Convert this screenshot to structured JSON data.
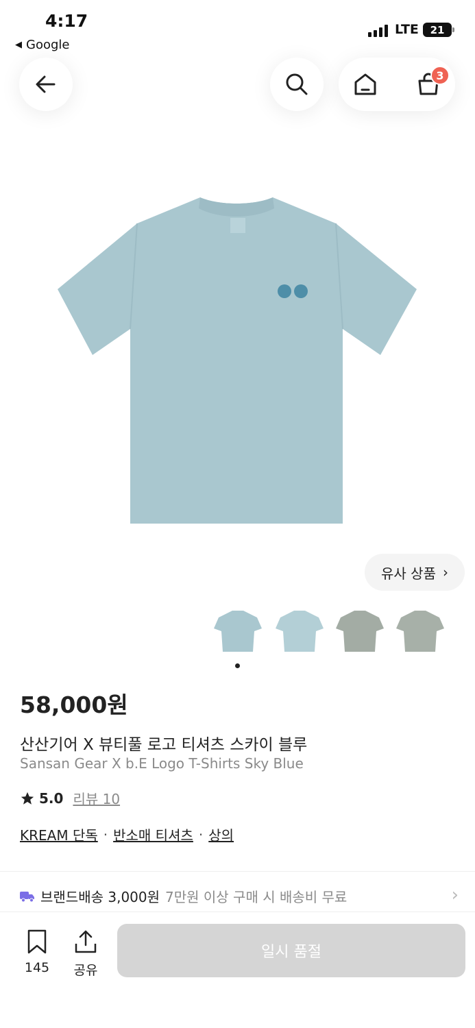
{
  "status": {
    "time": "4:17",
    "back_app": "Google",
    "network": "LTE",
    "battery": "21"
  },
  "header": {
    "cart_count": "3"
  },
  "product": {
    "price": "58,000원",
    "name_ko": "산산기어 X 뷰티풀 로고 티셔츠 스카이 블루",
    "name_en": "Sansan Gear X b.E Logo T-Shirts Sky Blue",
    "rating": "5.0",
    "reviews": "리뷰 10",
    "tags": [
      "KREAM 단독",
      "반소매 티셔츠",
      "상의"
    ],
    "tag_separator": "·",
    "similar_label": "유사 상품",
    "colors": {
      "shirt": "#a9c7cf",
      "shirt_shade": "#9dbcc5",
      "logo": "#4e8ea8",
      "grey_shirt": "#a3aca4"
    }
  },
  "shipping": {
    "brand_label": "브랜드배송 3,000원",
    "info": "7만원 이상 구매 시 배송비 무료"
  },
  "bottom": {
    "bookmark_count": "145",
    "share_label": "공유",
    "buy_label": "일시 품절"
  }
}
